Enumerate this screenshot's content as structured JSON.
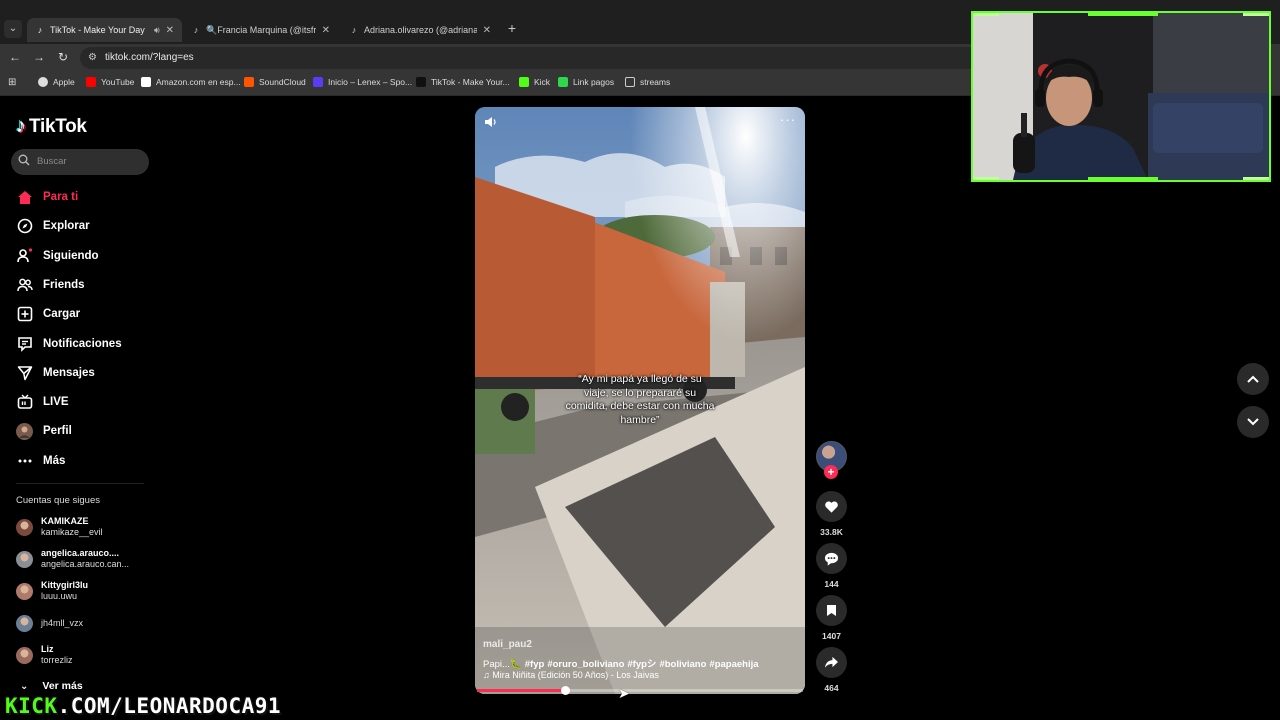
{
  "browser": {
    "tabs": [
      {
        "title": "TikTok - Make Your Day",
        "active": true
      },
      {
        "title": "🔍Francia Marquina (@itsfranc",
        "active": false
      },
      {
        "title": "Adriana.olivarezo (@adriana.oli",
        "active": false
      }
    ],
    "new_tab": "+",
    "url": "tiktok.com/?lang=es",
    "bookmarks": [
      {
        "label": "Apple",
        "color": "#dddddd"
      },
      {
        "label": "YouTube",
        "color": "#ff0000"
      },
      {
        "label": "Amazon.com en esp...",
        "color": "#ffffff"
      },
      {
        "label": "SoundCloud",
        "color": "#ff5500"
      },
      {
        "label": "Inicio – Lenex – Spo...",
        "color": "#5b3cf5"
      },
      {
        "label": "TikTok - Make Your...",
        "color": "#111111"
      },
      {
        "label": "Kick",
        "color": "#53fc18"
      },
      {
        "label": "Link pagos",
        "color": "#2bd94a"
      },
      {
        "label": "streams",
        "color": "#cccccc"
      }
    ]
  },
  "sidebar": {
    "logo": "TikTok",
    "search_placeholder": "Buscar",
    "nav": [
      {
        "label": "Para ti",
        "icon": "home-icon",
        "active": true
      },
      {
        "label": "Explorar",
        "icon": "compass-icon"
      },
      {
        "label": "Siguiendo",
        "icon": "following-icon"
      },
      {
        "label": "Friends",
        "icon": "friends-icon"
      },
      {
        "label": "Cargar",
        "icon": "upload-icon"
      },
      {
        "label": "Notificaciones",
        "icon": "inbox-icon"
      },
      {
        "label": "Mensajes",
        "icon": "send-icon"
      },
      {
        "label": "LIVE",
        "icon": "live-icon"
      },
      {
        "label": "Perfil",
        "icon": "profile-avatar-icon"
      },
      {
        "label": "Más",
        "icon": "more-dots-icon"
      }
    ],
    "following_title": "Cuentas que sigues",
    "following": [
      {
        "name": "KAMIKAZE",
        "user": "kamikaze__evil",
        "color": "#7a4a3c"
      },
      {
        "name": "angelica.arauco....",
        "user": "angelica.arauco.can...",
        "color": "#8a8f96"
      },
      {
        "name": "Kittygirl3lu",
        "user": "luuu.uwu",
        "color": "#b07a6a"
      },
      {
        "name": "",
        "user": "jh4mll_vzx",
        "color": "#6a7f95"
      },
      {
        "name": "Liz",
        "user": "torrezliz",
        "color": "#9a6a5c"
      }
    ],
    "more_label": "Ver más"
  },
  "overlay": {
    "kick_prefix": "KICK",
    "kick_rest": ".COM/LEONARDOCA91"
  },
  "video": {
    "caption": "“Ay mi papá ya llegó de su viaje, se lo prepararé su comidita, debe estar con mucha hambre”",
    "username": "mali_pau2",
    "desc_prefix": "Papi...🐛",
    "hashtags": [
      "#fyp",
      "#oruro_boliviano",
      "#fypシ",
      "#boliviano",
      "#papaehija"
    ],
    "music": "♫  Mira Niñita (Edición 50 Años) - Los Jaivas",
    "progress": 0.27
  },
  "actions": {
    "likes": "33.8K",
    "comments": "144",
    "saves": "1407",
    "shares": "464"
  },
  "colors": {
    "accent": "#fe2c55",
    "kick_green": "#53fc18",
    "webcam_border": "#6aff2f"
  }
}
